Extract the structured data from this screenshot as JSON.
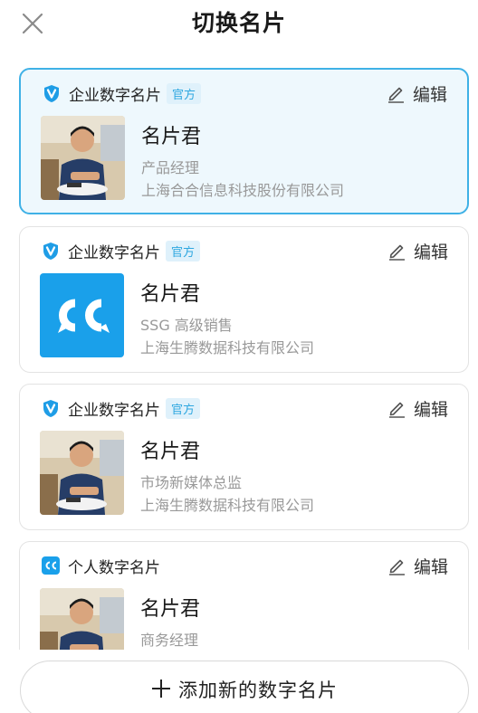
{
  "header": {
    "title": "切换名片",
    "close_icon": "close-icon"
  },
  "cards": [
    {
      "type_label": "企业数字名片",
      "badge": "官方",
      "type_icon": "verified-shield-icon",
      "edit_label": "编辑",
      "name": "名片君",
      "title": "产品经理",
      "company": "上海合合信息科技股份有限公司",
      "avatar": "person-photo",
      "selected": true
    },
    {
      "type_label": "企业数字名片",
      "badge": "官方",
      "type_icon": "verified-shield-icon",
      "edit_label": "编辑",
      "name": "名片君",
      "title": "SSG 高级销售",
      "company": "上海生腾数据科技有限公司",
      "avatar": "cc-logo",
      "selected": false
    },
    {
      "type_label": "企业数字名片",
      "badge": "官方",
      "type_icon": "verified-shield-icon",
      "edit_label": "编辑",
      "name": "名片君",
      "title": "市场新媒体总监",
      "company": "上海生腾数据科技有限公司",
      "avatar": "person-photo",
      "selected": false
    },
    {
      "type_label": "个人数字名片",
      "type_icon": "cc-icon",
      "edit_label": "编辑",
      "name": "名片君",
      "title": "商务经理",
      "avatar": "person-photo",
      "selected": false
    }
  ],
  "footer": {
    "add_label": "添加新的数字名片",
    "add_icon": "plus-icon"
  },
  "colors": {
    "accent": "#3fb1e6",
    "selected_bg": "#eef8fd",
    "badge_text": "#2ea7e0",
    "cc_blue": "#1aa0ea"
  }
}
